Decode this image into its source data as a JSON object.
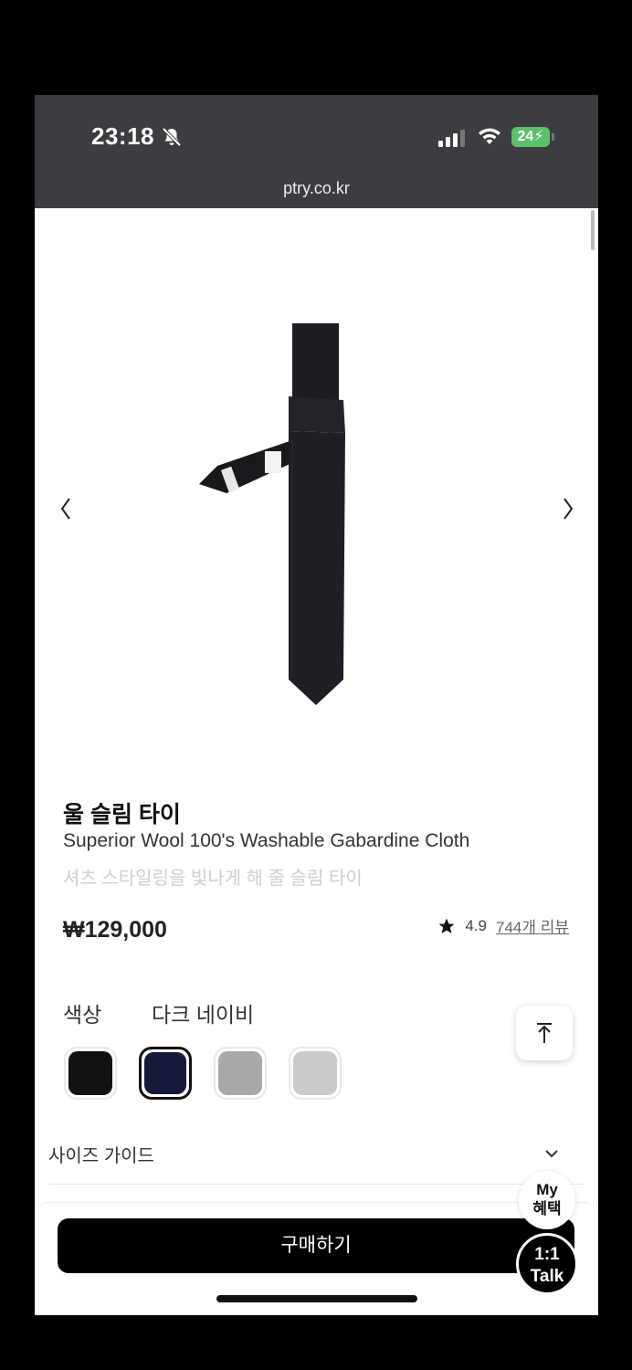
{
  "status_bar": {
    "time": "23:18",
    "battery": "24",
    "url": "ptry.co.kr"
  },
  "gallery": {
    "prev_icon": "chevron-left-icon",
    "next_icon": "chevron-right-icon"
  },
  "product": {
    "title": "울 슬림 타이",
    "subtitle": "Superior Wool 100's Washable Gabardine Cloth",
    "description": "셔츠 스타일링을 빛나게 해 줄 슬림 타이",
    "price": "₩129,000",
    "rating": "4.9",
    "review_link": "744개 리뷰"
  },
  "color": {
    "label": "색상",
    "selected_name": "다크 네이비",
    "swatches": [
      {
        "color": "#111111",
        "selected": false
      },
      {
        "color": "#16193a",
        "selected": true
      },
      {
        "color": "#a9a9ab",
        "selected": false
      },
      {
        "color": "#cbcbcc",
        "selected": false
      }
    ]
  },
  "size_guide": {
    "label": "사이즈 가이드"
  },
  "floating": {
    "my_benefit_line1": "My",
    "my_benefit_line2": "혜택",
    "talk_line1": "1:1",
    "talk_line2": "Talk"
  },
  "buy_button": {
    "label": "구매하기"
  },
  "colors": {
    "status_bar_bg": "#3b3d40",
    "battery_green": "#5ac06a",
    "product_tie": "#1c1d22"
  }
}
